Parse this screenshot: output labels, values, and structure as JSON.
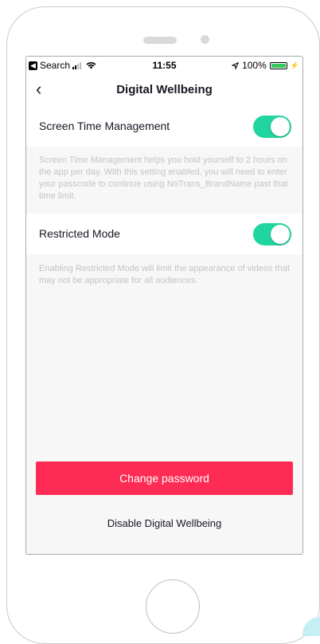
{
  "status_bar": {
    "back_app": "Search",
    "time": "11:55",
    "battery": "100%",
    "battery_level": 1.0
  },
  "header": {
    "title": "Digital Wellbeing",
    "back_icon": "chevron-left-icon"
  },
  "settings": [
    {
      "label": "Screen Time Management",
      "enabled": true,
      "description": "Screen Time Management helps you hold yourself to 2 hours on the app per day. With this setting enabled, you will need to enter your passcode to continue using NoTrans_BrandName past that time limit."
    },
    {
      "label": "Restricted Mode",
      "enabled": true,
      "description": "Enabling Restricted Mode will limit the appearance of videos that may not be appropriate for all audiences."
    }
  ],
  "actions": {
    "primary_label": "Change password",
    "secondary_label": "Disable Digital Wellbeing"
  },
  "colors": {
    "accent": "#fe2c55",
    "toggle_on": "#20d5a0",
    "background": "#f7f7f7",
    "description_text": "#c4c4c8"
  }
}
